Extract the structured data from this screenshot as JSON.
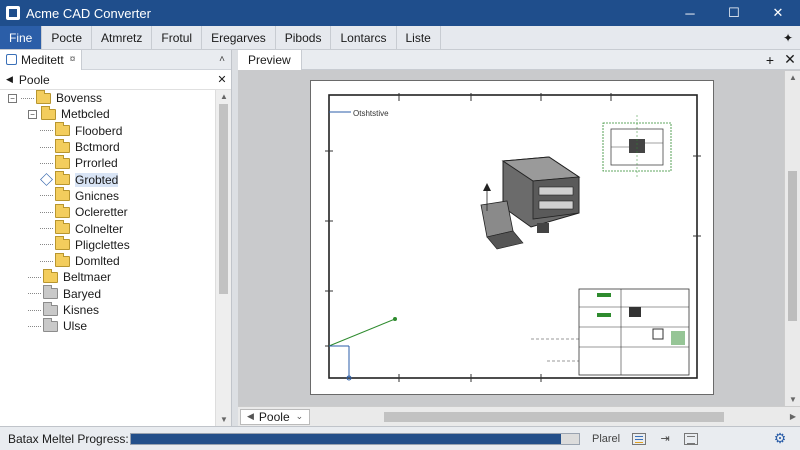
{
  "window": {
    "title": "Acme CAD Converter",
    "minimize": "─",
    "maximize": "☐",
    "close": "✕"
  },
  "menu": {
    "items": [
      {
        "label": "Fine",
        "active": true
      },
      {
        "label": "Pocte"
      },
      {
        "label": "Atmretz"
      },
      {
        "label": "Frotul"
      },
      {
        "label": "Eregarves"
      },
      {
        "label": "Pibods"
      },
      {
        "label": "Lontarcs"
      },
      {
        "label": "Liste"
      }
    ],
    "pin": "✦"
  },
  "left_panel": {
    "tab_label": "Meditett",
    "tab_close": "¤",
    "panel_chevron": "˄",
    "header_label": "Poole",
    "header_close": "✕",
    "tree": [
      {
        "label": "Bovenss",
        "indent": 0,
        "expander": "▫",
        "color": "yellow"
      },
      {
        "label": "Metbcled",
        "indent": 1,
        "expander": "⊟",
        "color": "yellow"
      },
      {
        "label": "Flooberd",
        "indent": 2,
        "color": "yellow"
      },
      {
        "label": "Bctmord",
        "indent": 2,
        "color": "yellow"
      },
      {
        "label": "Prrorled",
        "indent": 2,
        "color": "yellow"
      },
      {
        "label": "Grobted",
        "indent": 2,
        "color": "yellow",
        "selected": true
      },
      {
        "label": "Gnicnes",
        "indent": 2,
        "color": "yellow"
      },
      {
        "label": "Ocleretter",
        "indent": 2,
        "color": "yellow"
      },
      {
        "label": "Colnelter",
        "indent": 2,
        "color": "yellow"
      },
      {
        "label": "Pligclettes",
        "indent": 2,
        "color": "yellow"
      },
      {
        "label": "Domlted",
        "indent": 2,
        "color": "yellow"
      },
      {
        "label": "Beltmaer",
        "indent": 1,
        "color": "yellow"
      },
      {
        "label": "Baryed",
        "indent": 1,
        "color": "grey"
      },
      {
        "label": "Kisnes",
        "indent": 1,
        "color": "grey"
      },
      {
        "label": "Ulse",
        "indent": 1,
        "color": "grey"
      }
    ]
  },
  "document": {
    "tab_label": "Preview",
    "add_tab": "+",
    "close_tab": "✕",
    "layout_select": "Poole",
    "drawing_label": "Otshtstive"
  },
  "status": {
    "label": "Batax Meltel Progress:",
    "progress": 0.96,
    "panel_label": "Plarel",
    "settings": "⚙"
  },
  "colors": {
    "title_bar": "#1f4e8c",
    "accent": "#2b5ea8",
    "progress_fill": "#234f8a",
    "folder": "#f3cd5d",
    "dimension_green": "#2e8b2e"
  }
}
